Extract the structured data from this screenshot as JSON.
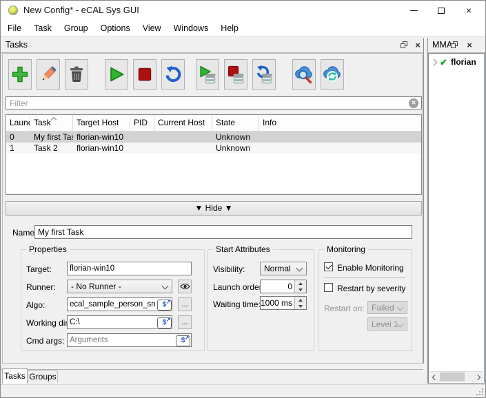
{
  "window": {
    "title": "New Config* - eCAL Sys GUI",
    "controls": {
      "minimize": "minimize",
      "maximize": "maximize",
      "close": "close"
    }
  },
  "menu": {
    "items": [
      "File",
      "Task",
      "Group",
      "Options",
      "View",
      "Windows",
      "Help"
    ]
  },
  "tasks_panel": {
    "title": "Tasks",
    "toolbar_icons": [
      "add-task",
      "edit-task",
      "delete-task",
      "start-tasks",
      "stop-tasks",
      "restart-tasks",
      "start-selected-tasks",
      "stop-selected-tasks",
      "restart-selected-tasks",
      "find-tasks-cloud",
      "update-from-cloud"
    ],
    "filter": {
      "placeholder": "Filter",
      "clear_icon": "clear-circle-x"
    },
    "table": {
      "columns": [
        "Launch",
        "Task",
        "Target Host",
        "PID",
        "Current Host",
        "State",
        "Info"
      ],
      "sort_column": "Task",
      "rows": [
        {
          "launch": "0",
          "task": "My first Task",
          "target_host": "florian-win10",
          "pid": "",
          "current_host": "",
          "state": "Unknown",
          "info": "",
          "selected": true
        },
        {
          "launch": "1",
          "task": "Task 2",
          "target_host": "florian-win10",
          "pid": "",
          "current_host": "",
          "state": "Unknown",
          "info": "",
          "selected": false
        }
      ]
    },
    "hide_button": "▼ Hide ▼",
    "details": {
      "name_label": "Name:",
      "name_value": "My first Task",
      "properties": {
        "title": "Properties",
        "target_label": "Target:",
        "target_value": "florian-win10",
        "runner_label": "Runner:",
        "runner_value": "- No Runner -",
        "algo_label": "Algo:",
        "algo_value": "ecal_sample_person_snd",
        "workdir_label": "Working dir:",
        "workdir_value": "C:\\",
        "cmdargs_label": "Cmd args:",
        "cmdargs_placeholder": "Arguments",
        "browse_label": "...",
        "env_icon": "$",
        "env_icon_arrow": "↗"
      },
      "start_attributes": {
        "title": "Start Attributes",
        "visibility_label": "Visibility:",
        "visibility_value": "Normal",
        "launch_order_label": "Launch order:",
        "launch_order_value": "0",
        "waiting_time_label": "Waiting time:",
        "waiting_time_value": "1000 ms"
      },
      "monitoring": {
        "title": "Monitoring",
        "enable_label": "Enable Monitoring",
        "enable_checked": true,
        "restart_label": "Restart by severity",
        "restart_checked": false,
        "restart_on_label": "Restart on:",
        "restart_on_value": "Failed",
        "level_value": "Level 1"
      }
    },
    "tabs": [
      {
        "label": "Tasks",
        "active": true
      },
      {
        "label": "Groups",
        "active": false
      }
    ]
  },
  "mma_panel": {
    "title": "MMA",
    "items": [
      {
        "label": "florian",
        "status_icon": "green-check"
      }
    ]
  },
  "colors": {
    "selected_row": "#d2d2d2",
    "accent_green": "#2db52d",
    "accent_red": "#b00f0f",
    "accent_blue": "#1f5fd0",
    "check_green": "#1ca227"
  }
}
